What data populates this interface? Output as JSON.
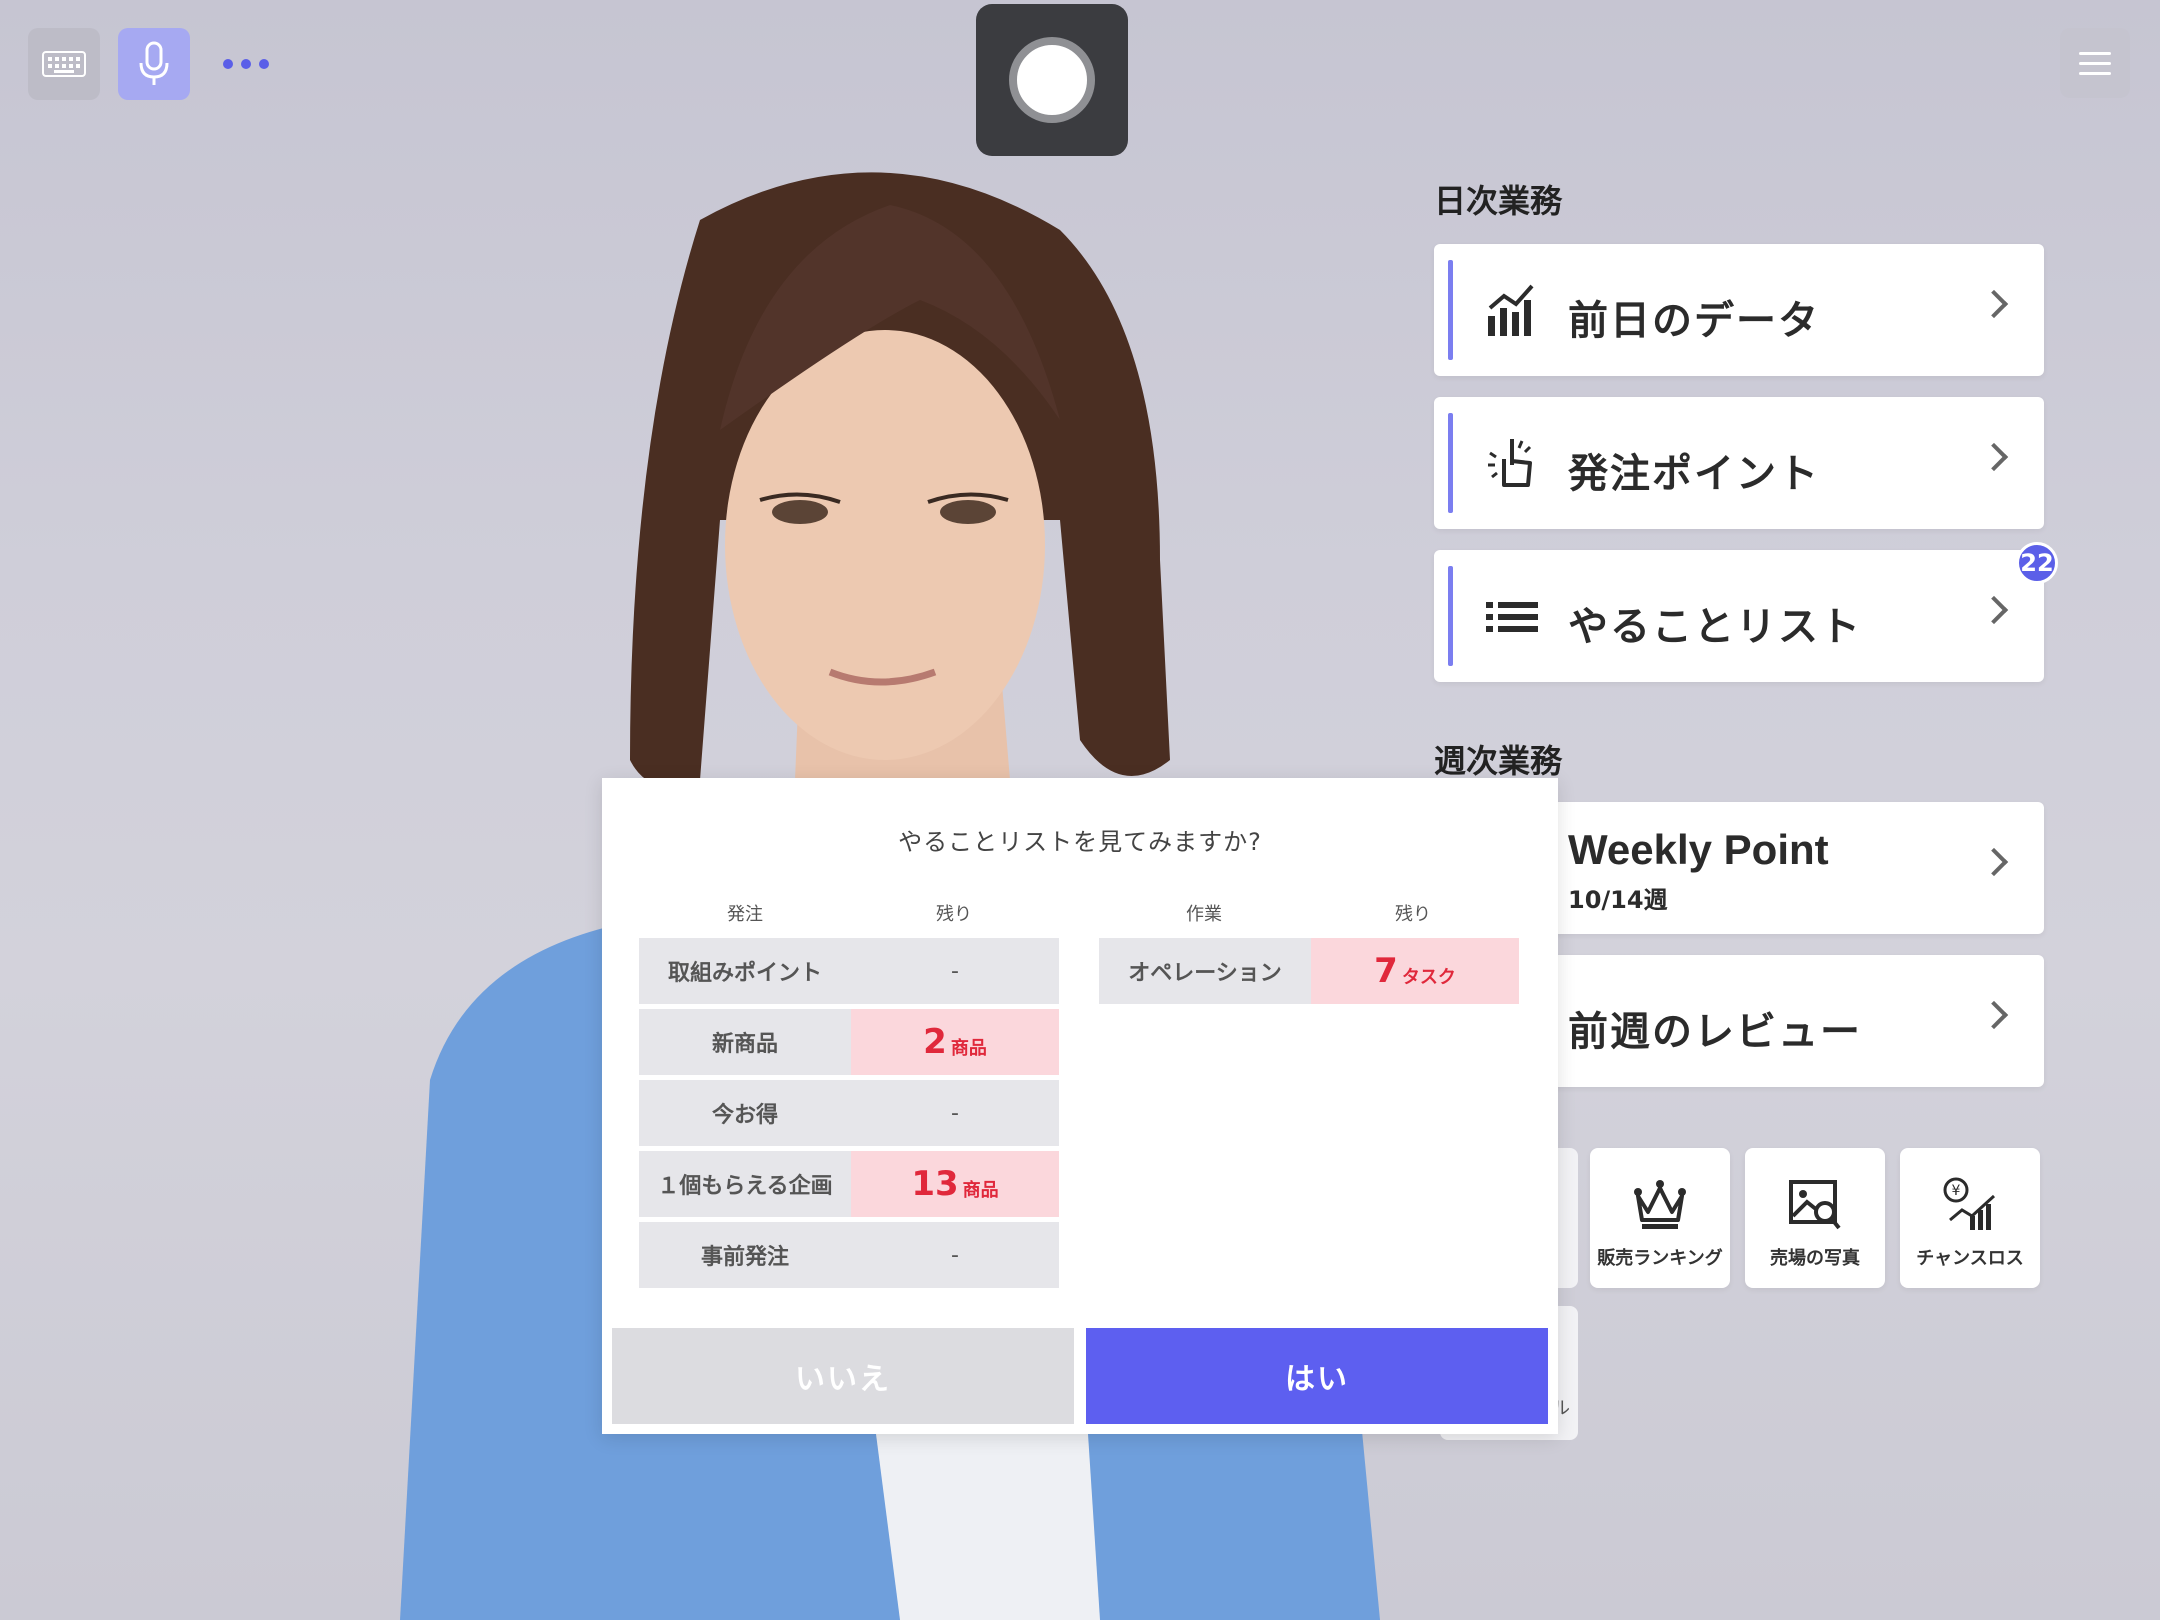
{
  "topbar": {
    "keyboard_icon": "keyboard-icon",
    "mic_icon": "microphone-icon",
    "more_icon": "more-dots-icon",
    "record_icon": "record-button-icon",
    "menu_icon": "hamburger-menu-icon"
  },
  "daily": {
    "heading": "日次業務",
    "items": [
      {
        "label": "前日のデータ",
        "icon": "bar-chart-icon"
      },
      {
        "label": "発注ポイント",
        "icon": "pointing-hand-icon"
      },
      {
        "label": "やることリスト",
        "icon": "list-icon",
        "badge": "22"
      }
    ]
  },
  "weekly": {
    "heading": "週次業務",
    "items": [
      {
        "label": "Weekly Point",
        "sub": "10/14週"
      },
      {
        "label": "前週のレビュー"
      }
    ]
  },
  "tools": [
    {
      "label": "販売ランキング",
      "icon": "crown-icon"
    },
    {
      "label": "売場の写真",
      "icon": "photo-search-icon"
    },
    {
      "label": "チャンスロス",
      "icon": "yen-chart-icon"
    }
  ],
  "partial_tile_text": "ル",
  "dialog": {
    "question": "やることリストを見てみますか?",
    "left_headers": [
      "発注",
      "残り"
    ],
    "right_headers": [
      "作業",
      "残り"
    ],
    "order_rows": [
      {
        "name": "取組みポイント",
        "value": "-",
        "num": "",
        "unit": ""
      },
      {
        "name": "新商品",
        "value": "",
        "num": "2",
        "unit": "商品"
      },
      {
        "name": "今お得",
        "value": "-",
        "num": "",
        "unit": ""
      },
      {
        "name": "１個もらえる企画",
        "value": "",
        "num": "13",
        "unit": "商品"
      },
      {
        "name": "事前発注",
        "value": "-",
        "num": "",
        "unit": ""
      }
    ],
    "task_rows": [
      {
        "name": "オペレーション",
        "num": "7",
        "unit": "タスク"
      }
    ],
    "no_label": "いいえ",
    "yes_label": "はい"
  },
  "colors": {
    "accent": "#5d5ff0",
    "highlight": "#fbd7dc",
    "alert": "#e0283b"
  }
}
